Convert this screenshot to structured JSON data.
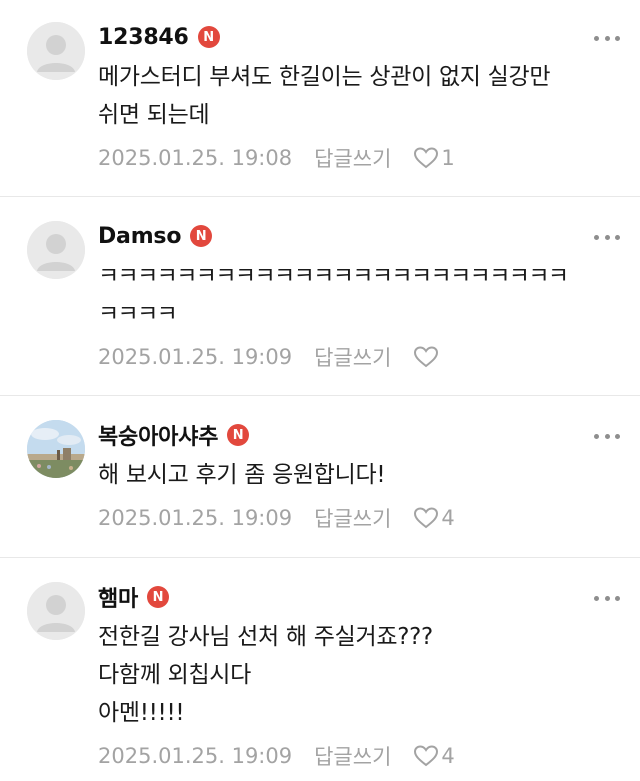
{
  "comments": [
    {
      "username": "123846",
      "badge": "N",
      "lines": [
        "메가스터디 부셔도 한길이는 상관이 없지 실강만",
        "쉬면 되는데"
      ],
      "timestamp": "2025.01.25. 19:08",
      "reply_label": "답글쓰기",
      "like_count": "1",
      "avatar": "default-avatar"
    },
    {
      "username": "Damso",
      "badge": "N",
      "lines": [
        "ㅋㅋㅋㅋㅋㅋㅋㅋㅋㅋㅋㅋㅋㅋㅋㅋㅋㅋㅋㅋㅋㅋㅋㅋ",
        "ㅋㅋㅋㅋ"
      ],
      "timestamp": "2025.01.25. 19:09",
      "reply_label": "답글쓰기",
      "like_count": "",
      "avatar": "default-avatar"
    },
    {
      "username": "복숭아아샤추",
      "badge": "N",
      "lines": [
        "해 보시고 후기 좀 응원합니다!"
      ],
      "timestamp": "2025.01.25. 19:09",
      "reply_label": "답글쓰기",
      "like_count": "4",
      "avatar": "photo-avatar"
    },
    {
      "username": "햄마",
      "badge": "N",
      "lines": [
        "전한길 강사님 선처 해 주실거죠???",
        "다함께 외칩시다",
        "아멘!!!!!"
      ],
      "timestamp": "2025.01.25. 19:09",
      "reply_label": "답글쓰기",
      "like_count": "4",
      "avatar": "default-avatar"
    }
  ],
  "colors": {
    "badge": "#e2483d",
    "meta_text": "#a3a3a3",
    "divider": "#e8e8e8"
  },
  "icons": [
    "more-icon",
    "heart-icon",
    "default-avatar-icon",
    "new-badge"
  ]
}
